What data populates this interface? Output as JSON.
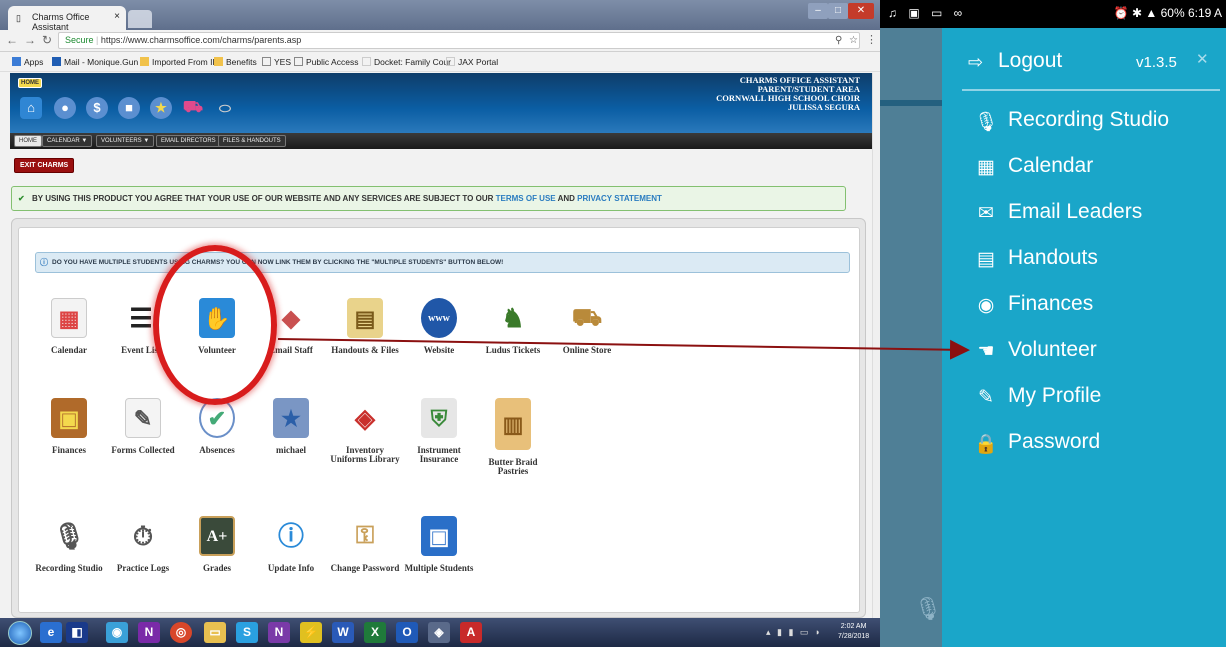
{
  "browser": {
    "tab_title": "Charms Office Assistant",
    "tab_close": "×",
    "address": {
      "secure_label": "Secure",
      "url": "https://www.charmsoffice.com/charms/parents.asp"
    },
    "bookmarks": [
      "Apps",
      "Mail - Monique.Gun",
      "Imported From IE",
      "Benefits",
      "YES",
      "Public Access",
      "Docket: Family Cour",
      "JAX Portal"
    ]
  },
  "charms": {
    "home_badge": "HOME",
    "header_lines": [
      "CHARMS OFFICE ASSISTANT",
      "PARENT/STUDENT AREA",
      "CORNWALL HIGH SCHOOL CHOIR",
      "JULISSA SEGURA"
    ],
    "menu": [
      "HOME",
      "CALENDAR",
      "VOLUNTEERS",
      "EMAIL DIRECTORS",
      "FILES & HANDOUTS"
    ],
    "exit_label": "EXIT CHARMS",
    "agree_text": "BY USING THIS PRODUCT YOU AGREE THAT YOUR USE OF OUR WEBSITE AND ANY SERVICES ARE SUBJECT TO OUR",
    "terms_link": "TERMS OF USE",
    "and_text": "AND",
    "privacy_link": "PRIVACY STATEMENT",
    "notice_text": "DO YOU HAVE MULTIPLE STUDENTS USING CHARMS? YOU CAN NOW LINK THEM BY CLICKING THE \"MULTIPLE STUDENTS\" BUTTON BELOW!",
    "tiles_row1": [
      "Calendar",
      "Event List",
      "Volunteer",
      "Email Staff",
      "Handouts & Files",
      "Website",
      "Ludus Tickets",
      "Online Store"
    ],
    "tiles_row2": [
      "Finances",
      "Forms Collected",
      "Absences",
      "michael",
      "Inventory Uniforms Library",
      "Instrument Insurance",
      "Butter Braid Pastries"
    ],
    "tiles_row3": [
      "Recording Studio",
      "Practice Logs",
      "Grades",
      "Update Info",
      "Change Password",
      "Multiple Students"
    ]
  },
  "taskbar": {
    "time": "2:02 AM",
    "date": "7/28/2018"
  },
  "phone": {
    "status_right": "60% 6:19 A",
    "logout_label": "Logout",
    "version": "v1.3.5",
    "menu_items": [
      "Recording Studio",
      "Calendar",
      "Email Leaders",
      "Handouts",
      "Finances",
      "Volunteer",
      "My Profile",
      "Password"
    ]
  },
  "colors": {
    "accent_red": "#d81c1c",
    "phone_drawer": "#1aa6c9",
    "charms_blue": "#0b5ea4"
  }
}
